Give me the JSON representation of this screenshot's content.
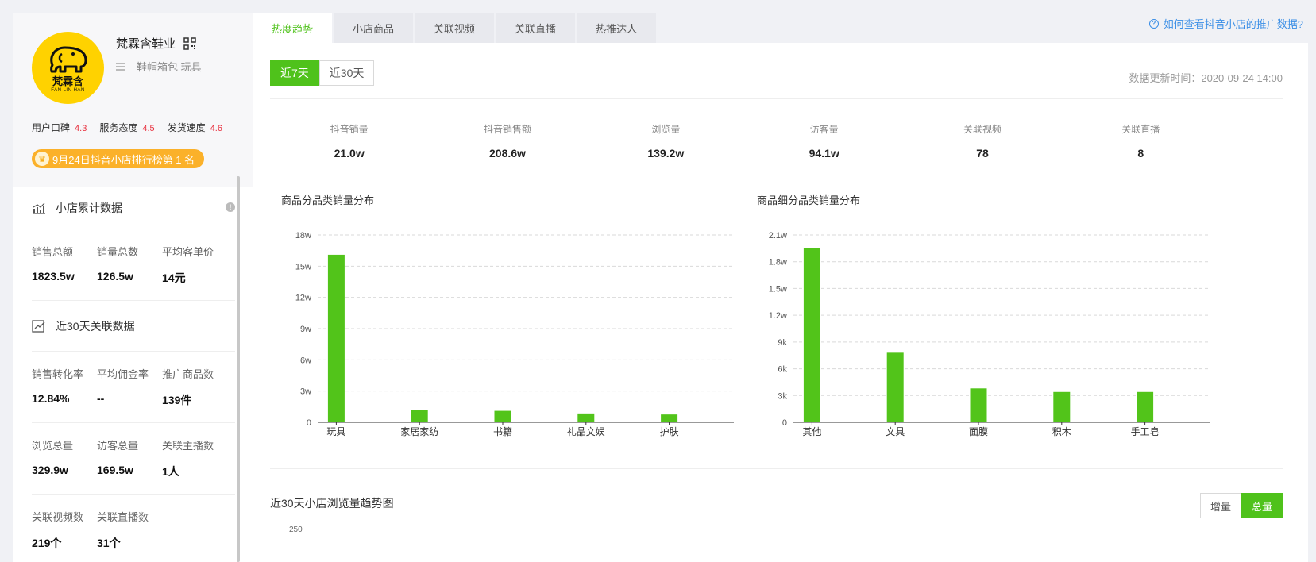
{
  "shop": {
    "name": "梵霖含鞋业",
    "category": "鞋帽箱包 玩具",
    "logo_text": "梵霖含",
    "logo_sub": "FAN LIN HAN",
    "ratings": [
      {
        "label": "用户口碑",
        "value": "4.3"
      },
      {
        "label": "服务态度",
        "value": "4.5"
      },
      {
        "label": "发货速度",
        "value": "4.6"
      }
    ],
    "rank_badge": "9月24日抖音小店排行榜第 1 名"
  },
  "cumulative": {
    "title": "小店累计数据",
    "items": [
      {
        "label": "销售总额",
        "value": "1823.5w"
      },
      {
        "label": "销量总数",
        "value": "126.5w"
      },
      {
        "label": "平均客单价",
        "value": "14元"
      }
    ]
  },
  "recent30": {
    "title": "近30天关联数据",
    "rows": [
      [
        {
          "label": "销售转化率",
          "value": "12.84%"
        },
        {
          "label": "平均佣金率",
          "value": "--"
        },
        {
          "label": "推广商品数",
          "value": "139件"
        }
      ],
      [
        {
          "label": "浏览总量",
          "value": "329.9w"
        },
        {
          "label": "访客总量",
          "value": "169.5w"
        },
        {
          "label": "关联主播数",
          "value": "1人"
        }
      ],
      [
        {
          "label": "关联视频数",
          "value": "219个"
        },
        {
          "label": "关联直播数",
          "value": "31个"
        }
      ]
    ]
  },
  "tabs": [
    "热度趋势",
    "小店商品",
    "关联视频",
    "关联直播",
    "热推达人"
  ],
  "help_link": "如何查看抖音小店的推广数据?",
  "period": {
    "options": [
      "近7天",
      "近30天"
    ],
    "selected": "近7天"
  },
  "update_time": "数据更新时间：2020-09-24 14:00",
  "kpis": [
    {
      "label": "抖音销量",
      "value": "21.0w"
    },
    {
      "label": "抖音销售额",
      "value": "208.6w"
    },
    {
      "label": "浏览量",
      "value": "139.2w"
    },
    {
      "label": "访客量",
      "value": "94.1w"
    },
    {
      "label": "关联视频",
      "value": "78"
    },
    {
      "label": "关联直播",
      "value": "8"
    }
  ],
  "trend": {
    "title": "近30天小店浏览量趋势图",
    "toggle": [
      "增量",
      "总量"
    ],
    "toggle_selected": "总量",
    "first_tick": "250"
  },
  "chart_data": [
    {
      "type": "bar",
      "title": "商品分品类销量分布",
      "categories": [
        "玩具",
        "家居家纺",
        "书籍",
        "礼品文娱",
        "护肤"
      ],
      "values": [
        161000,
        11500,
        11000,
        8500,
        7500
      ],
      "yticks": [
        "0",
        "3w",
        "6w",
        "9w",
        "12w",
        "15w",
        "18w"
      ],
      "ylim": [
        0,
        180000
      ],
      "grid": true,
      "color": "#52c41a"
    },
    {
      "type": "bar",
      "title": "商品细分品类销量分布",
      "categories": [
        "其他",
        "文具",
        "面膜",
        "积木",
        "手工皂"
      ],
      "values": [
        19500,
        7800,
        3800,
        3400,
        3400
      ],
      "yticks": [
        "0",
        "3k",
        "6k",
        "9k",
        "1.2w",
        "1.5w",
        "1.8w",
        "2.1w"
      ],
      "ylim": [
        0,
        21000
      ],
      "grid": true,
      "color": "#52c41a"
    }
  ]
}
